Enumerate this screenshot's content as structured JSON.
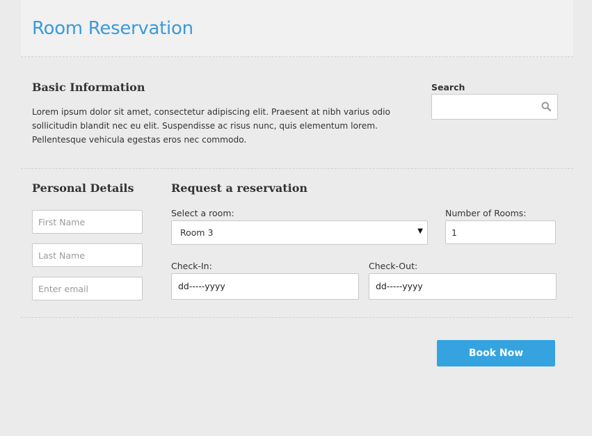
{
  "header": {
    "title": "Room Reservation"
  },
  "basic_info": {
    "title": "Basic Information",
    "text": "Lorem ipsum dolor sit amet, consectetur adipiscing elit. Praesent at nibh varius odio sollicitudin blandit nec eu elit. Suspendisse ac risus nunc, quis elementum lorem. Pellentesque vehicula egestas eros nec commodo."
  },
  "search": {
    "label": "Search",
    "value": "",
    "placeholder": "",
    "icon": "search-icon"
  },
  "personal_details": {
    "title": "Personal Details",
    "first_name_placeholder": "First Name",
    "last_name_placeholder": "Last Name",
    "email_placeholder": "Enter email"
  },
  "reservation": {
    "title": "Request a reservation",
    "room_label": "Select a room:",
    "room_value": "Room 3",
    "rooms_count_label": "Number of Rooms:",
    "rooms_count_value": "1",
    "checkin_label": "Check-In:",
    "checkin_value": "dd-----yyyy",
    "checkout_label": "Check-Out:",
    "checkout_value": "dd-----yyyy"
  },
  "actions": {
    "book_label": "Book Now"
  },
  "colors": {
    "accent": "#3b9ad9",
    "button": "#36a3e1",
    "background": "#ebebeb",
    "header_bg": "#f1f1f1"
  }
}
